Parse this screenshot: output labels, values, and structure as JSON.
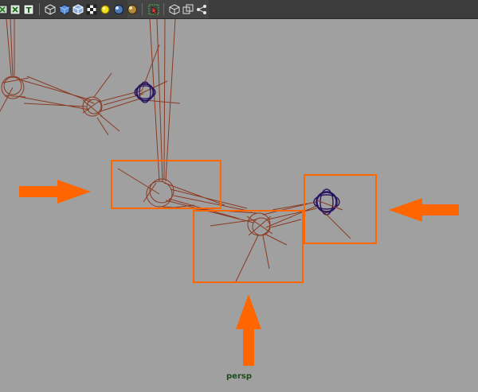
{
  "toolbar": {
    "buttons": [
      {
        "icon": "select-camera-icon"
      },
      {
        "icon": "image-plane-icon"
      },
      {
        "icon": "text-icon",
        "glyph": "T"
      },
      {
        "icon": "wireframe-cube-icon"
      },
      {
        "icon": "smooth-shade-cube-icon"
      },
      {
        "icon": "wireframe-on-shaded-icon"
      },
      {
        "icon": "textured-checker-icon"
      },
      {
        "icon": "default-lighting-icon"
      },
      {
        "icon": "all-lights-icon"
      },
      {
        "icon": "shadows-icon"
      },
      {
        "icon": "isolate-select-icon"
      },
      {
        "icon": "xray-cube-icon"
      },
      {
        "icon": "xray-joints-icon"
      },
      {
        "icon": "hierarchy-icon"
      }
    ]
  },
  "viewport": {
    "camera_name": "persp",
    "background_color": "#a0a0a0",
    "joint_color": "#8a3a22",
    "control_color": "#2a1660",
    "highlight_color": "#ff6600"
  }
}
